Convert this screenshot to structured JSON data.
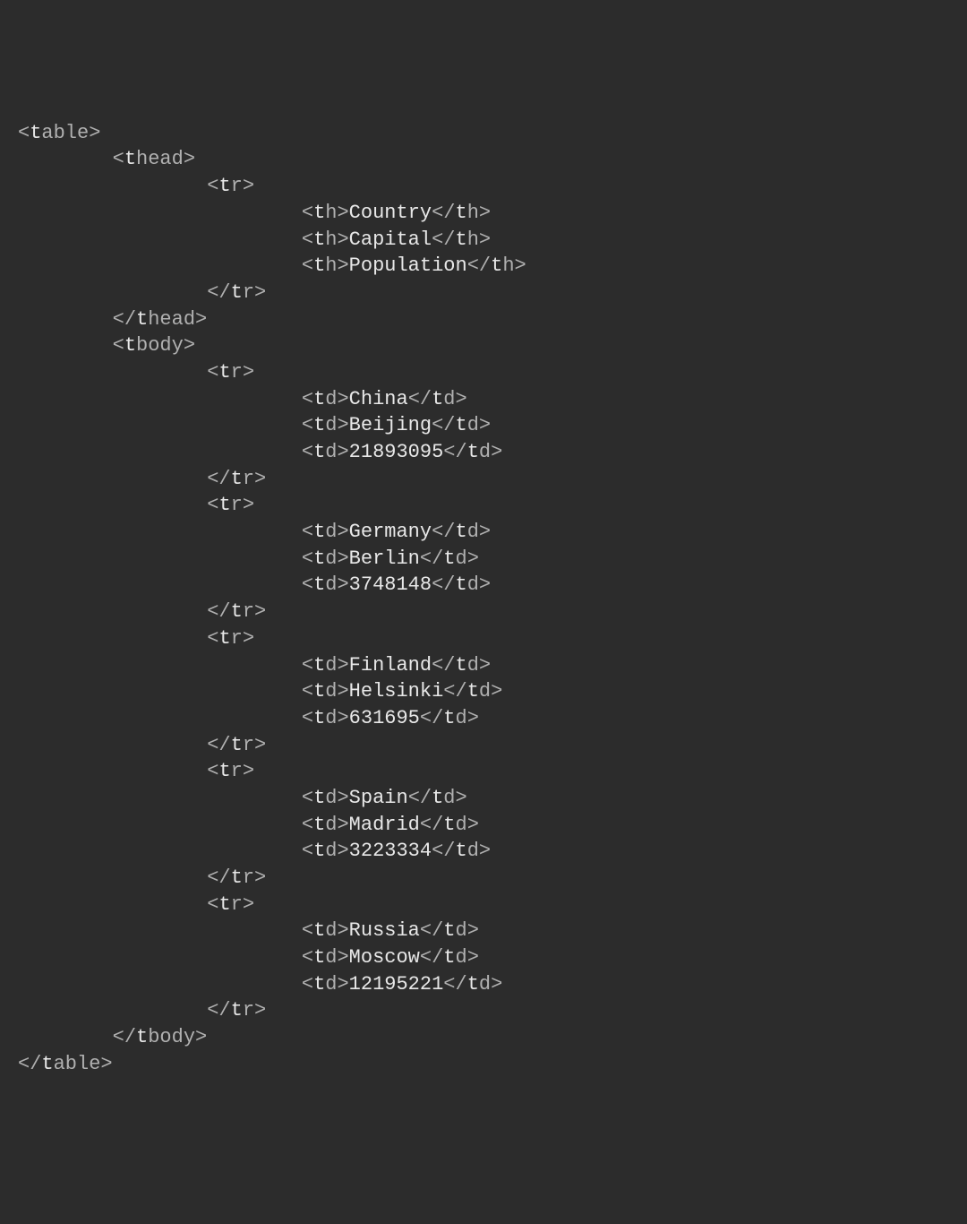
{
  "code": {
    "lines": [
      {
        "indent": 0,
        "text": "<table>"
      },
      {
        "indent": 1,
        "text": "<thead>"
      },
      {
        "indent": 2,
        "text": "<tr>"
      },
      {
        "indent": 3,
        "text": "<th>Country</th>"
      },
      {
        "indent": 3,
        "text": "<th>Capital</th>"
      },
      {
        "indent": 3,
        "text": "<th>Population</th>"
      },
      {
        "indent": 2,
        "text": "</tr>"
      },
      {
        "indent": 1,
        "text": "</thead>"
      },
      {
        "indent": 1,
        "text": "<tbody>"
      },
      {
        "indent": 2,
        "text": "<tr>"
      },
      {
        "indent": 3,
        "text": "<td>China</td>"
      },
      {
        "indent": 3,
        "text": "<td>Beijing</td>"
      },
      {
        "indent": 3,
        "text": "<td>21893095</td>"
      },
      {
        "indent": 2,
        "text": "</tr>"
      },
      {
        "indent": 2,
        "text": "<tr>"
      },
      {
        "indent": 3,
        "text": "<td>Germany</td>"
      },
      {
        "indent": 3,
        "text": "<td>Berlin</td>"
      },
      {
        "indent": 3,
        "text": "<td>3748148</td>"
      },
      {
        "indent": 2,
        "text": "</tr>"
      },
      {
        "indent": 2,
        "text": "<tr>"
      },
      {
        "indent": 3,
        "text": "<td>Finland</td>"
      },
      {
        "indent": 3,
        "text": "<td>Helsinki</td>"
      },
      {
        "indent": 3,
        "text": "<td>631695</td>"
      },
      {
        "indent": 2,
        "text": "</tr>"
      },
      {
        "indent": 2,
        "text": "<tr>"
      },
      {
        "indent": 3,
        "text": "<td>Spain</td>"
      },
      {
        "indent": 3,
        "text": "<td>Madrid</td>"
      },
      {
        "indent": 3,
        "text": "<td>3223334</td>"
      },
      {
        "indent": 2,
        "text": "</tr>"
      },
      {
        "indent": 2,
        "text": "<tr>"
      },
      {
        "indent": 3,
        "text": "<td>Russia</td>"
      },
      {
        "indent": 3,
        "text": "<td>Moscow</td>"
      },
      {
        "indent": 3,
        "text": "<td>12195221</td>"
      },
      {
        "indent": 2,
        "text": "</tr>"
      },
      {
        "indent": 1,
        "text": "</tbody>"
      },
      {
        "indent": 0,
        "text": "</table>"
      }
    ]
  },
  "table_data": {
    "headers": [
      "Country",
      "Capital",
      "Population"
    ],
    "rows": [
      {
        "country": "China",
        "capital": "Beijing",
        "population": "21893095"
      },
      {
        "country": "Germany",
        "capital": "Berlin",
        "population": "3748148"
      },
      {
        "country": "Finland",
        "capital": "Helsinki",
        "population": "631695"
      },
      {
        "country": "Spain",
        "capital": "Madrid",
        "population": "3223334"
      },
      {
        "country": "Russia",
        "capital": "Moscow",
        "population": "12195221"
      }
    ]
  }
}
